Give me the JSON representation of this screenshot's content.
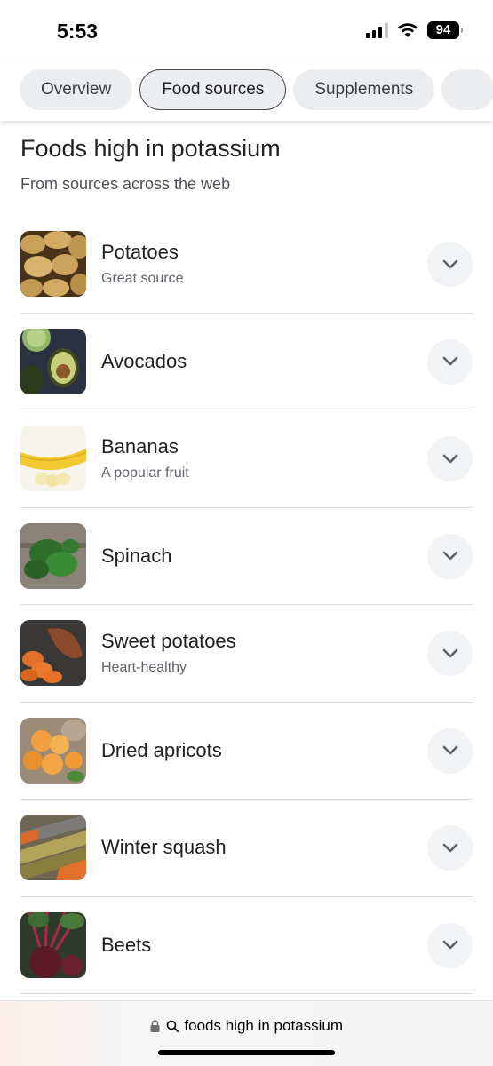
{
  "status": {
    "time": "5:53",
    "battery": "94"
  },
  "tabs": [
    {
      "label": "Overview",
      "active": false
    },
    {
      "label": "Food sources",
      "active": true
    },
    {
      "label": "Supplements",
      "active": false
    }
  ],
  "header": {
    "title": "Foods high in potassium",
    "subtitle": "From sources across the web"
  },
  "foods": [
    {
      "name": "Potatoes",
      "note": "Great source",
      "icon": "potatoes-image"
    },
    {
      "name": "Avocados",
      "note": "",
      "icon": "avocados-image"
    },
    {
      "name": "Bananas",
      "note": "A popular fruit",
      "icon": "bananas-image"
    },
    {
      "name": "Spinach",
      "note": "",
      "icon": "spinach-image"
    },
    {
      "name": "Sweet potatoes",
      "note": "Heart-healthy",
      "icon": "sweet-potatoes-image"
    },
    {
      "name": "Dried apricots",
      "note": "",
      "icon": "dried-apricots-image"
    },
    {
      "name": "Winter squash",
      "note": "",
      "icon": "winter-squash-image"
    },
    {
      "name": "Beets",
      "note": "",
      "icon": "beets-image"
    }
  ],
  "address_bar": {
    "query": "foods high in potassium"
  },
  "colors": {
    "chip_bg": "#ebedef",
    "divider": "#dadce0",
    "expand_bg": "#f1f3f4"
  }
}
